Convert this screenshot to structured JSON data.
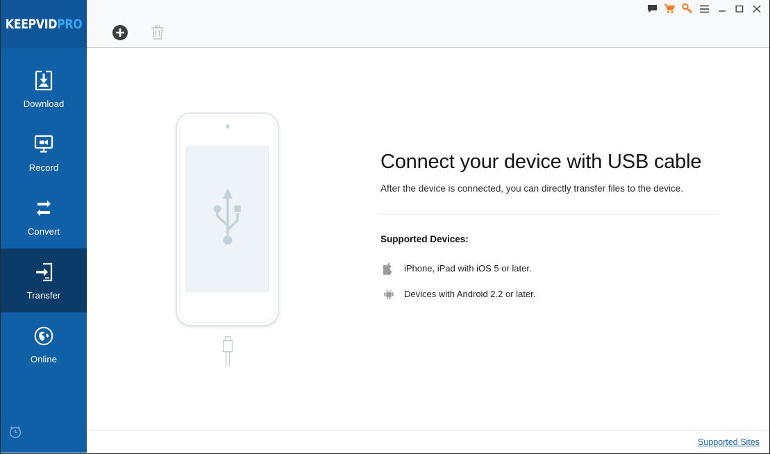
{
  "app": {
    "brand_primary": "KEEPVID",
    "brand_secondary": "PRO",
    "sidebar_color": "#1060a8",
    "sidebar_active_color": "#0b3c69",
    "accent_orange": "#f07b1d",
    "link_color": "#1464a5"
  },
  "titlebar": {
    "buttons": [
      {
        "name": "feedback-icon",
        "label": "Feedback"
      },
      {
        "name": "cart-icon",
        "label": "Buy"
      },
      {
        "name": "key-icon",
        "label": "Register"
      },
      {
        "name": "menu-icon",
        "label": "Menu"
      },
      {
        "name": "minimize-icon",
        "label": "Minimize"
      },
      {
        "name": "maximize-icon",
        "label": "Maximize"
      },
      {
        "name": "close-icon",
        "label": "Close"
      }
    ]
  },
  "toolbar": {
    "add_label": "Add",
    "delete_label": "Delete"
  },
  "sidebar": {
    "items": [
      {
        "label": "Download",
        "icon": "download-icon",
        "active": false
      },
      {
        "label": "Record",
        "icon": "record-icon",
        "active": false
      },
      {
        "label": "Convert",
        "icon": "convert-icon",
        "active": false
      },
      {
        "label": "Transfer",
        "icon": "transfer-icon",
        "active": true
      },
      {
        "label": "Online",
        "icon": "globe-icon",
        "active": false
      }
    ],
    "bottom_icon": "alarm-clock-icon"
  },
  "main": {
    "headline": "Connect your device with USB cable",
    "subline": "After the device is connected, you can directly transfer files to the device.",
    "supported_title": "Supported Devices:",
    "devices": [
      {
        "icon": "apple-icon",
        "text": "iPhone, iPad with iOS 5 or later."
      },
      {
        "icon": "android-icon",
        "text": "Devices with Android 2.2 or later."
      }
    ],
    "illustration": {
      "device": "smartphone-outline",
      "screen_symbol": "usb-trident-icon",
      "cable": "usb-connector-icon"
    }
  },
  "statusbar": {
    "supported_sites_label": "Supported Sites"
  }
}
